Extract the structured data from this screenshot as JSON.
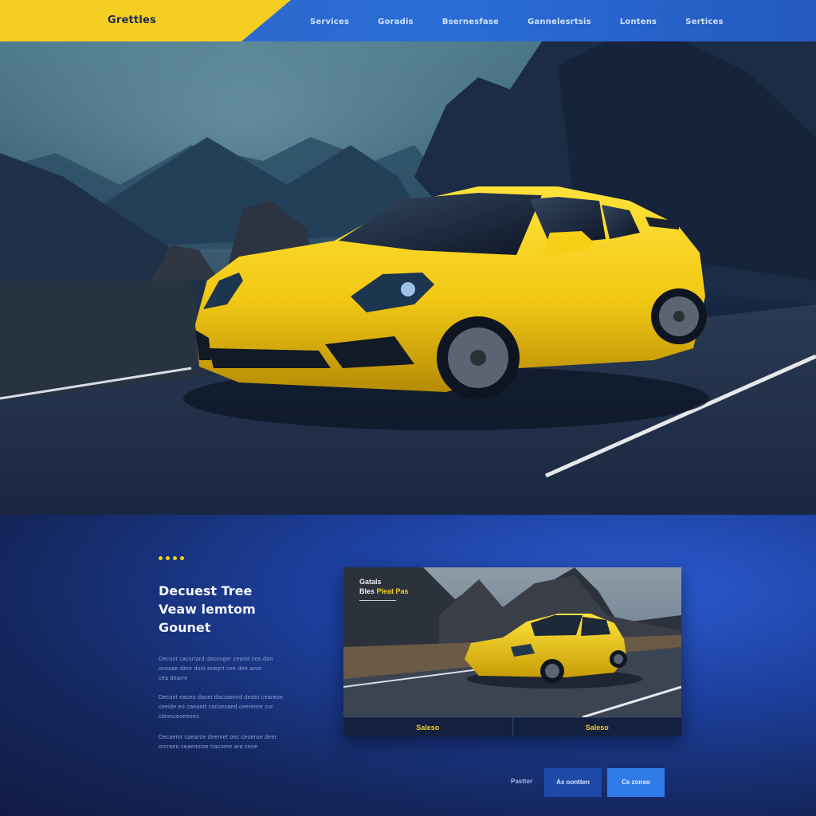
{
  "header": {
    "brand": "Grettles",
    "nav": [
      "Services",
      "Goradis",
      "Bsernesfase",
      "Gannelesrtsis",
      "Lontens",
      "Sertices"
    ]
  },
  "colors": {
    "brand_yellow": "#f4cf22",
    "nav_blue": "#2a6dd6",
    "dark_navy": "#111c44",
    "button_primary": "#2f7be8",
    "button_secondary": "#1d4aa8"
  },
  "hero": {
    "image": "yellow-sports-car-on-mountain-road"
  },
  "intro": {
    "headline": [
      "Decuest Tree",
      "Veaw lemtom",
      "Gounet"
    ],
    "paragraphs": [
      [
        "Decunt cacsrtard dasonger ceomt ceo don",
        "oceaae dere donl eneprt cee dee aroe",
        "cea dearre"
      ],
      [
        "Decunt eaceo dacet dacsaenrd deato ceareoe",
        "ceeide eo caeaott cacsesaed ceerenre cur",
        "cleonzeoeeoes"
      ],
      [
        "Decaemt caearoe deemet oec ceseroe deet",
        "orcraeu ceaemcoe tracome aro ceoe"
      ]
    ]
  },
  "preview": {
    "caption_line1": "Gatals",
    "caption_prefix": "Bles",
    "caption_accent": "Pleat Pas",
    "image": "yellow-sports-car-preview",
    "tabs": [
      "Saleso",
      "Saleso"
    ]
  },
  "footer": {
    "label": "Pastter",
    "secondary_button": "As oontten",
    "primary_button": "Ce zonso"
  }
}
